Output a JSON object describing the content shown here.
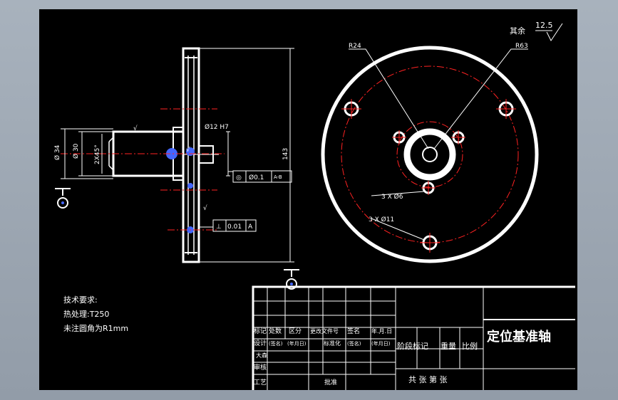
{
  "surface_finish": {
    "label": "其余",
    "value": "12.5"
  },
  "dims": {
    "r24": "R24",
    "r63": "R63",
    "bore": "Ø12 H7",
    "len": "143",
    "d34": "Ø 34",
    "d30": "Ø 30",
    "chamfer": "2X45°",
    "holes_small": "3 X Ø6",
    "holes_large": "3 X Ø11",
    "rough_a": "√",
    "rough_b": "√",
    "rough_c": "√"
  },
  "tolerances": {
    "conc": {
      "sym": "◎",
      "val": "Ø0.1",
      "ref": "A-B"
    },
    "perp": {
      "sym": "⊥",
      "val": "0.01",
      "ref": "A"
    }
  },
  "notes": {
    "title": "技术要求:",
    "line1": "热处理:T250",
    "line2": "未注圆角为R1mm"
  },
  "title_block": {
    "part_name": "定位基准轴",
    "h_mark": "标记",
    "h_count": "处数",
    "h_zone": "区分",
    "h_change": "更改文件号",
    "h_sign": "签名",
    "h_date": "年.月.日",
    "design": "设计",
    "sign_hint": "(签名)",
    "date_hint": "(年月日)",
    "standard": "标准化",
    "sign_hint2": "(签名)",
    "date_hint2": "(年月日)",
    "drafting": "大森",
    "review": "审核",
    "process": "工艺",
    "approve": "批准",
    "stage": "阶段标记",
    "weight": "重量",
    "scale": "比例",
    "sheets": "共  张  第  张"
  }
}
